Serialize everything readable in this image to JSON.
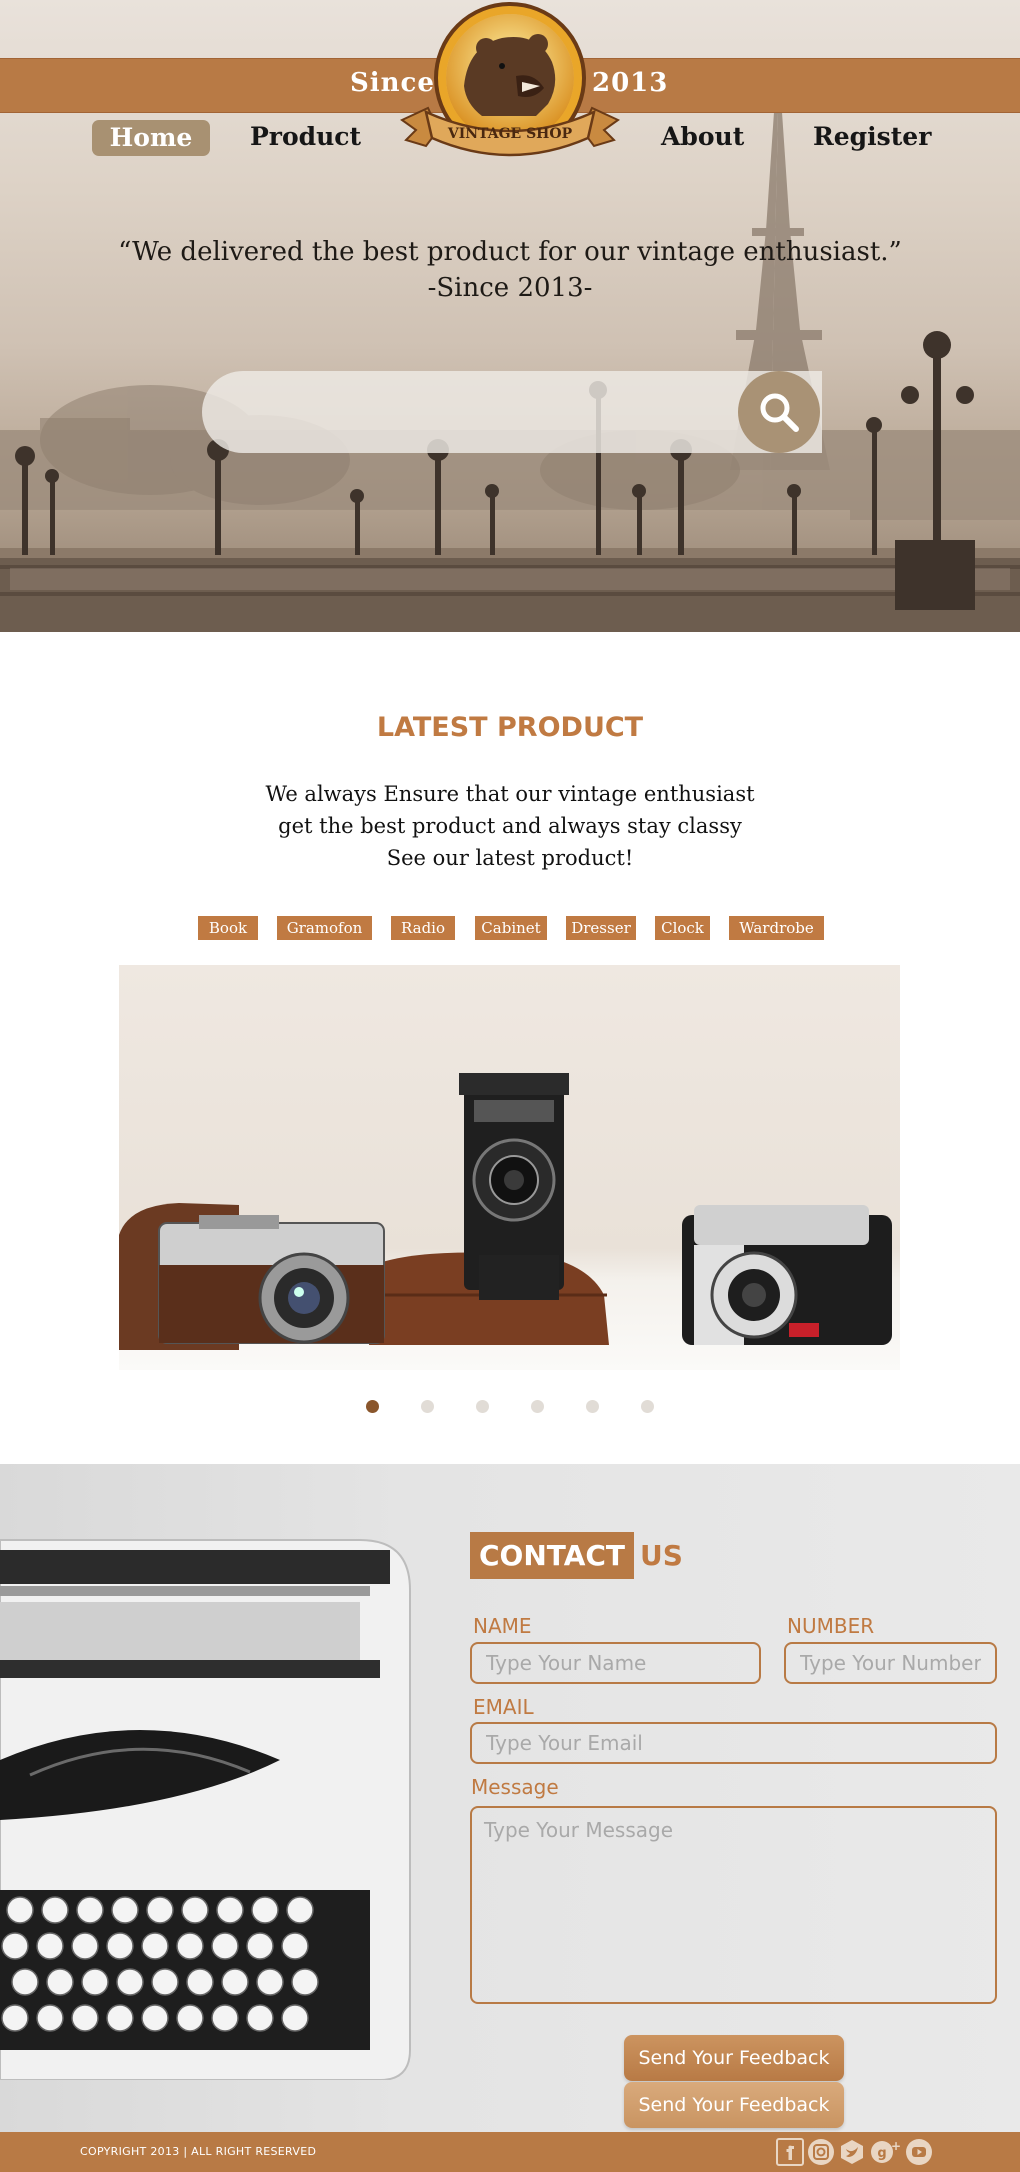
{
  "header": {
    "since_label": "Since",
    "year_label": "2013",
    "logo_text": "VINTAGE SHOP"
  },
  "nav": {
    "items": [
      {
        "label": "Home",
        "active": true
      },
      {
        "label": "Product"
      },
      {
        "label": "About"
      },
      {
        "label": "Register"
      }
    ]
  },
  "hero": {
    "quote_line1": "“We delivered the best product for our  vintage enthusiast.”",
    "quote_line2": "-Since 2013-",
    "search_icon": "search-icon"
  },
  "latest": {
    "title": "LATEST PRODUCT",
    "desc_line1": "We always Ensure that our vintage enthusiast",
    "desc_line2": "get the best product and always stay classy",
    "desc_line3": "See our latest product!",
    "categories": [
      "Book",
      "Gramofon",
      "Radio",
      "Cabinet",
      "Dresser",
      "Clock",
      "Wardrobe"
    ],
    "slider": {
      "slides": 6,
      "active": 1
    }
  },
  "contact": {
    "title_part1": "CONTACT",
    "title_part2": "US",
    "name_label": "NAME",
    "name_placeholder": "Type Your Name",
    "number_label": "NUMBER",
    "number_placeholder": "Type Your Number",
    "email_label": "EMAIL",
    "email_placeholder": "Type Your Email",
    "message_label": "Message",
    "message_placeholder": "Type Your Message",
    "submit_label": "Send Your Feedback",
    "submit_hover_label": "Send Your Feedback"
  },
  "footer": {
    "copyright": "COPYRIGHT 2013 | ALL RIGHT RESERVED",
    "social": [
      "facebook-icon",
      "instagram-icon",
      "twitter-icon",
      "google-plus-icon",
      "youtube-icon"
    ]
  },
  "colors": {
    "brand_brown": "#b87a45",
    "accent_text": "#c07a42",
    "nav_active_bg": "#a89172",
    "dot_active": "#8a562c"
  }
}
